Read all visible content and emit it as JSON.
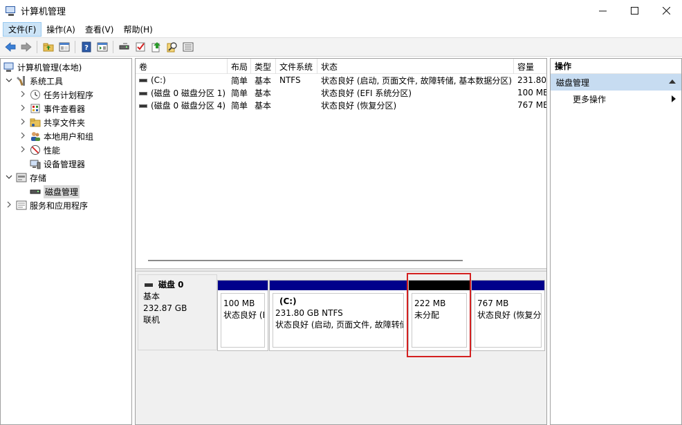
{
  "window": {
    "title": "计算机管理"
  },
  "menu": [
    "文件(F)",
    "操作(A)",
    "查看(V)",
    "帮助(H)"
  ],
  "toolbar": {
    "icons": [
      "back-arrow-icon",
      "forward-arrow-icon",
      "up-folder-icon",
      "show-hide-tree-icon",
      "help-icon",
      "properties-icon",
      "disk-icon",
      "check-icon",
      "export-icon",
      "search-icon",
      "list-icon"
    ]
  },
  "tree": {
    "root": "计算机管理(本地)",
    "system_tools": "系统工具",
    "task_scheduler": "任务计划程序",
    "event_viewer": "事件查看器",
    "shared_folders": "共享文件夹",
    "local_users": "本地用户和组",
    "performance": "性能",
    "device_manager": "设备管理器",
    "storage": "存储",
    "disk_management": "磁盘管理",
    "services": "服务和应用程序"
  },
  "volumes": {
    "columns": [
      "卷",
      "布局",
      "类型",
      "文件系统",
      "状态",
      "容量"
    ],
    "rows": [
      [
        "(C:)",
        "简单",
        "基本",
        "NTFS",
        "状态良好 (启动, 页面文件, 故障转储, 基本数据分区)",
        "231.80"
      ],
      [
        "(磁盘 0 磁盘分区 1)",
        "简单",
        "基本",
        "",
        "状态良好 (EFI 系统分区)",
        "100 ME"
      ],
      [
        "(磁盘 0 磁盘分区 4)",
        "简单",
        "基本",
        "",
        "状态良好 (恢复分区)",
        "767 ME"
      ]
    ]
  },
  "disk": {
    "name": "磁盘 0",
    "type": "基本",
    "size": "232.87 GB",
    "status": "联机",
    "partitions": [
      {
        "title": "",
        "size": "100 MB",
        "status": "状态良好 (E"
      },
      {
        "title": "(C:)",
        "size": "231.80 GB NTFS",
        "status": "状态良好 (启动, 页面文件, 故障转储"
      },
      {
        "title": "",
        "size": "222 MB",
        "status": "未分配"
      },
      {
        "title": "",
        "size": "767 MB",
        "status": "状态良好 (恢复分"
      }
    ]
  },
  "actions": {
    "header": "操作",
    "section": "磁盘管理",
    "more": "更多操作"
  },
  "colors": {
    "partition_bar": "#00008b",
    "unallocated_bar": "#000000",
    "highlight": "#d42020",
    "action_section_bg": "#c7dcf1"
  }
}
